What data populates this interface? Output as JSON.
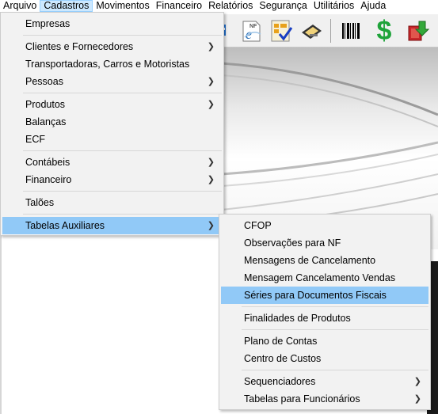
{
  "menubar": {
    "items": [
      "Arquivo",
      "Cadastros",
      "Movimentos",
      "Financeiro",
      "Relatórios",
      "Segurança",
      "Utilitários",
      "Ajuda"
    ]
  },
  "cadastros_menu": {
    "items": [
      {
        "label": "Empresas"
      },
      {
        "label": "Clientes e Fornecedores"
      },
      {
        "label": "Transportadoras, Carros e Motoristas"
      },
      {
        "label": "Pessoas"
      },
      {
        "label": "Produtos"
      },
      {
        "label": "Balanças"
      },
      {
        "label": "ECF"
      },
      {
        "label": "Contábeis"
      },
      {
        "label": "Financeiro"
      },
      {
        "label": "Talões"
      },
      {
        "label": "Tabelas Auxiliares"
      }
    ]
  },
  "tabelas_submenu": {
    "items": [
      {
        "label": "CFOP"
      },
      {
        "label": "Observações para NF"
      },
      {
        "label": "Mensagens de Cancelamento"
      },
      {
        "label": "Mensagem Cancelamento Vendas"
      },
      {
        "label": "Séries para Documentos Fiscais"
      },
      {
        "label": "Finalidades de Produtos"
      },
      {
        "label": "Plano de Contas"
      },
      {
        "label": "Centro de Custos"
      },
      {
        "label": "Sequenciadores"
      },
      {
        "label": "Tabelas para Funcionários"
      }
    ]
  },
  "toolbar": {
    "icons": [
      "nfe-icon",
      "checklist-icon",
      "card-machine-icon",
      "barcode-icon",
      "dollar-icon",
      "exit-icon"
    ],
    "nfe_label": "NF",
    "dollar_label": "$"
  },
  "colors": {
    "highlight": "#91c9f7",
    "menubar_active": "#cce8ff",
    "dollar_green": "#1fa33a",
    "exit_red": "#d9262a"
  }
}
